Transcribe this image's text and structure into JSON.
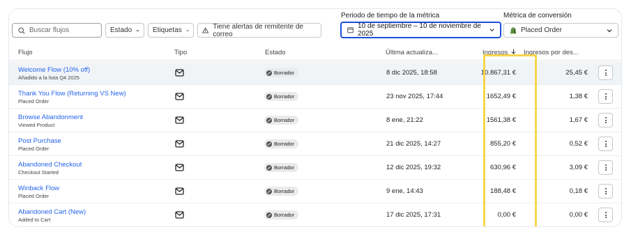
{
  "filters": {
    "search_placeholder": "Buscar flujos",
    "estado_label": "Estado",
    "etiquetas_label": "Etiquetas",
    "alerts_label": "Tiene alertas de remitente de correo",
    "period_title": "Periodo de tiempo de la métrica",
    "period_value": "10 de septiembre – 10 de noviembre de 2025",
    "metric_title": "Métrica de conversión",
    "metric_value": "Placed Order"
  },
  "table": {
    "headers": {
      "flujo": "Flujo",
      "tipo": "Tipo",
      "estado": "Estado",
      "ultima": "Última actualiza...",
      "ingresos": "Ingresos",
      "ingresos_por": "Ingresos por des..."
    },
    "rows": [
      {
        "name": "Welcome Flow (10% off)",
        "sub": "Añadido a la lista Q4 2025",
        "status": "Borrador",
        "date": "8 dic 2025, 18:58",
        "revenue": "10.867,31 €",
        "rpd": "25,45 €"
      },
      {
        "name": "Thank You Flow (Returning VS New)",
        "sub": "Placed Order",
        "status": "Borrador",
        "date": "23 nov 2025, 17:44",
        "revenue": "1652,49 €",
        "rpd": "1,38 €"
      },
      {
        "name": "Browse Abandonment",
        "sub": "Viewed Product",
        "status": "Borrador",
        "date": "8 ene, 21:22",
        "revenue": "1561,38 €",
        "rpd": "1,67 €"
      },
      {
        "name": "Post Purchase",
        "sub": "Placed Order",
        "status": "Borrador",
        "date": "21 dic 2025, 14:27",
        "revenue": "855,20 €",
        "rpd": "0,52 €"
      },
      {
        "name": "Abandoned Checkout",
        "sub": "Checkout Started",
        "status": "Borrador",
        "date": "12 dic 2025, 19:32",
        "revenue": "630,96 €",
        "rpd": "3,09 €"
      },
      {
        "name": "Winback Flow",
        "sub": "Placed Order",
        "status": "Borrador",
        "date": "9 ene, 14:43",
        "revenue": "188,48 €",
        "rpd": "0,18 €"
      },
      {
        "name": "Abandoned Cart (New)",
        "sub": "Added to Cart",
        "status": "Borrador",
        "date": "17 dic 2025, 17:31",
        "revenue": "0,00 €",
        "rpd": "0,00 €"
      }
    ]
  },
  "icons": {
    "type": "mail-icon",
    "status": "draft-icon",
    "row_menu": "more-vertical-icon"
  },
  "colors": {
    "link": "#2563eb",
    "period_border": "#1d4ed8",
    "highlight_box": "#f5d74a",
    "shopify_green": "#5e8e3e"
  }
}
